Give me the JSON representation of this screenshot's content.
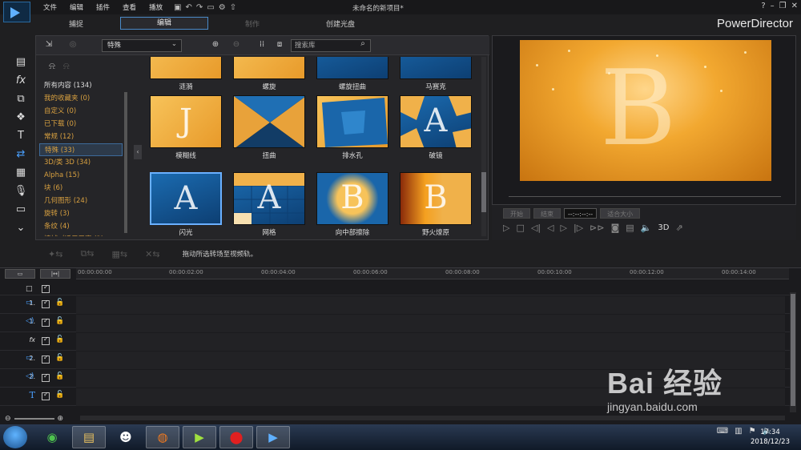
{
  "menu": [
    "文件",
    "编辑",
    "插件",
    "查看",
    "播放"
  ],
  "doc_title": "未命名的新项目*",
  "modes": [
    "捕捉",
    "编辑",
    "制作",
    "创建光盘"
  ],
  "brand": "PowerDirector",
  "library": {
    "category_select": "特殊",
    "search_placeholder": "搜索库",
    "categories": [
      "所有内容 (134)",
      "我的收藏夹 (0)",
      "自定义 (0)",
      "已下载 (0)",
      "常规 (12)",
      "特殊 (33)",
      "3D/类 3D (34)",
      "Alpha (15)",
      "块 (6)",
      "几何图形 (24)",
      "旋转 (3)",
      "条纹 (4)",
      "擦拭（适用于高 (2)"
    ],
    "top_row": [
      "涟漪",
      "螺旋",
      "螺旋扭曲",
      "马赛克"
    ],
    "mid_row": [
      "模糊线",
      "扭曲",
      "排水孔",
      "破镜"
    ],
    "bottom_row": [
      "闪光",
      "网格",
      "向中部擦除",
      "野火燎原"
    ],
    "tile_letters": {
      "blur": "J",
      "crack": "A",
      "flash": "A",
      "grid": "A",
      "center": "B",
      "fire": "B"
    }
  },
  "preview": {
    "letter": "B"
  },
  "playback": {
    "start_label": "开始",
    "end_label": "结束",
    "timecode": "--:--:--:--",
    "size_label": "适合大小",
    "mode_3d": "3D"
  },
  "hint": "拖动所选转场至视频轨。",
  "timeline": {
    "ticks": [
      "00:00:00:00",
      "00:00:02:00",
      "00:00:04:00",
      "00:00:06:00",
      "00:00:08:00",
      "00:00:10:00",
      "00:00:12:00",
      "00:00:14:00"
    ],
    "tracks": [
      "1.",
      "1.",
      "fx",
      "2.",
      "2.",
      "T"
    ]
  },
  "taskbar": {
    "time": "17:34",
    "date": "2018/12/23"
  },
  "watermark": {
    "main": "Bai 经验",
    "sub": "jingyan.baidu.com"
  }
}
